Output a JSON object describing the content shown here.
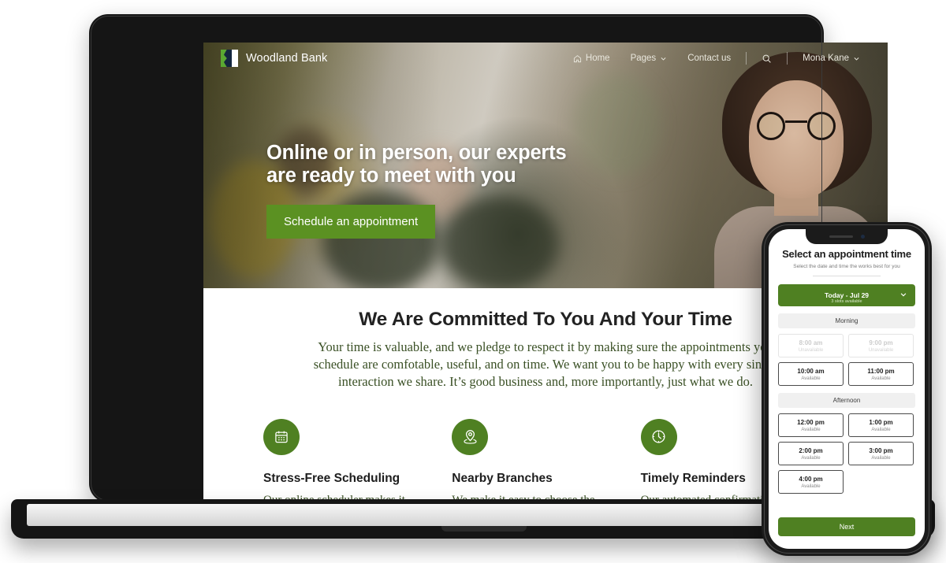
{
  "site": {
    "brand": {
      "name": "Woodland Bank",
      "logo_icon": "woodland-bank-logo"
    },
    "nav": [
      {
        "label": "Home",
        "icon": "home-icon",
        "has_chevron": false
      },
      {
        "label": "Pages",
        "icon": "",
        "has_chevron": true
      },
      {
        "label": "Contact us",
        "icon": "",
        "has_chevron": false
      }
    ],
    "search_icon": "search-icon",
    "account": {
      "label": "Mona Kane",
      "has_chevron": true
    }
  },
  "hero": {
    "title_line1": "Online or in person, our experts",
    "title_line2": "are ready to meet with you",
    "cta_label": "Schedule an appointment"
  },
  "section": {
    "heading": "We Are Committed To You And Your Time",
    "lede": "Your time is valuable, and we pledge to respect it by making sure the appointments you schedule are comfotable, useful, and on time. We want you to be happy with every single interaction we share. It’s good business and, more importantly, just what we do."
  },
  "features": [
    {
      "icon": "calendar-icon",
      "title": "Stress-Free Scheduling",
      "text": "Our online scheduler makes it easy to get the meeting time"
    },
    {
      "icon": "location-pin-icon",
      "title": "Nearby Branches",
      "text": "We make it easy to choose the location to meet that is"
    },
    {
      "icon": "clock-icon",
      "title": "Timely Reminders",
      "text": "Our automated confirmation and reminder messages helps"
    }
  ],
  "phone_app": {
    "title": "Select an appointment time",
    "subtitle": "Select the date and time the works best for you",
    "date_selector": {
      "label": "Today - Jul 29",
      "sublabel": "3 slots available",
      "chevron_icon": "chevron-down-icon"
    },
    "groups": [
      {
        "label": "Morning",
        "slots": [
          {
            "time": "8:00 am",
            "state": "Unavailable",
            "available": false
          },
          {
            "time": "9:00 pm",
            "state": "Unavailable",
            "available": false
          },
          {
            "time": "10:00 am",
            "state": "Available",
            "available": true
          },
          {
            "time": "11:00 pm",
            "state": "Available",
            "available": true
          }
        ]
      },
      {
        "label": "Afternoon",
        "slots": [
          {
            "time": "12:00 pm",
            "state": "Available",
            "available": true
          },
          {
            "time": "1:00 pm",
            "state": "Available",
            "available": true
          },
          {
            "time": "2:00 pm",
            "state": "Available",
            "available": true
          },
          {
            "time": "3:00 pm",
            "state": "Available",
            "available": true
          },
          {
            "time": "4:00 pm",
            "state": "Available",
            "available": true
          }
        ]
      }
    ],
    "next_label": "Next"
  },
  "colors": {
    "brand_green": "#4f8022",
    "cta_green": "#5b9122",
    "logo_green": "#5aa832",
    "logo_navy": "#13263f",
    "body_green_text": "#3a5025",
    "device_frame": "#151515"
  }
}
